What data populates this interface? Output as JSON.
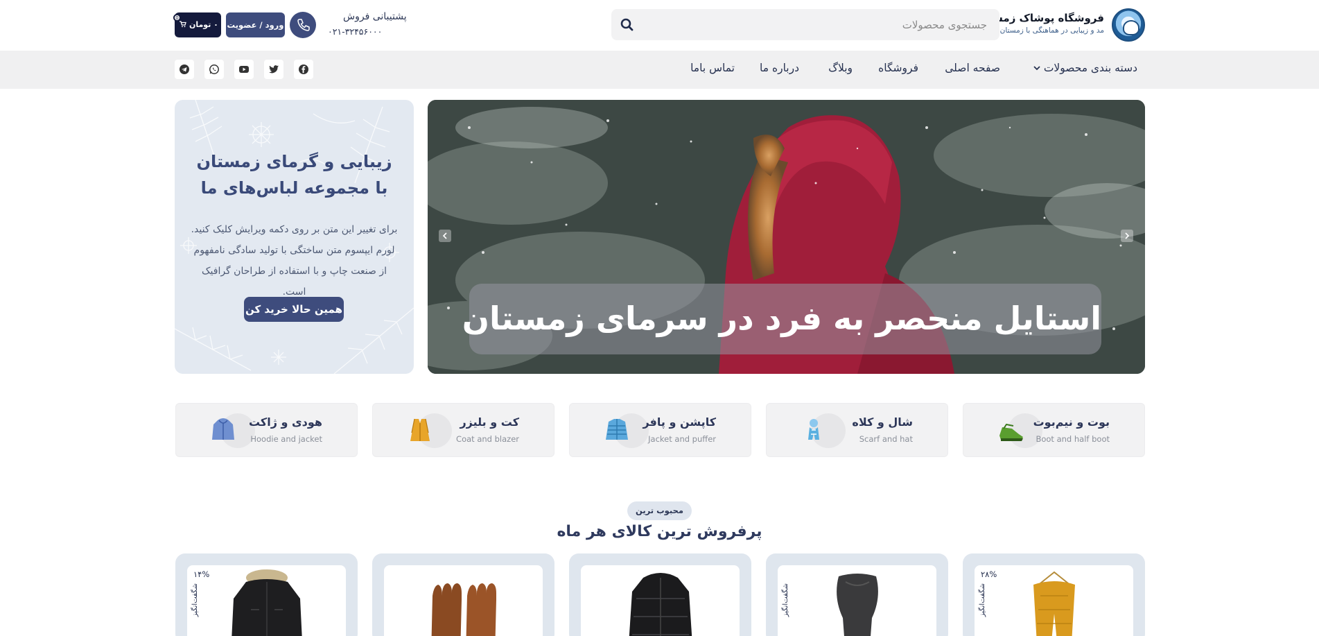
{
  "header": {
    "brand_title": "فروشگاه پوشاک زمستانه",
    "brand_subtitle": "مد و زیبایی در هماهنگی با زمستان",
    "search_placeholder": "جستجوی محصولات",
    "support_label": "پشتیبانی فروش",
    "support_phone": "۰۲۱-۳۲۴۵۶۰۰۰",
    "login_label": "ورود / عضویت",
    "cart_label": "۰ تومان",
    "cart_count": "0"
  },
  "nav": {
    "items": [
      "دسته بندی محصولات",
      "صفحه اصلی",
      "فروشگاه",
      "وبلاگ",
      "درباره ما",
      "تماس باما"
    ],
    "social": [
      "facebook-icon",
      "twitter-icon",
      "youtube-icon",
      "whatsapp-icon",
      "telegram-icon"
    ]
  },
  "promo": {
    "title": "زیبایی و گرمای زمستان با مجموعه لباس‌های ما",
    "text": "برای تغییر این متن بر روی دکمه ویرایش کلیک کنید. لورم ایپسوم متن ساختگی با تولید سادگی نامفهوم از صنعت چاپ و با استفاده از طراحان گرافیک است.",
    "button": "همین حالا خرید کن"
  },
  "slider": {
    "caption": "استایل منحصر به فرد در سرمای زمستان"
  },
  "categories": [
    {
      "title": "بوت و نیم‌بوت",
      "subtitle": "Boot and half boot",
      "icon": "boot-icon",
      "color": "#5a9e2f"
    },
    {
      "title": "شال و کلاه",
      "subtitle": "Scarf and hat",
      "icon": "scarf-icon",
      "color": "#5ab0e0"
    },
    {
      "title": "کاپشن و پافر",
      "subtitle": "Jacket and puffer",
      "icon": "puffer-icon",
      "color": "#5aa8dc"
    },
    {
      "title": "کت و بلیزر",
      "subtitle": "Coat and blazer",
      "icon": "coat-icon",
      "color": "#e8a52a"
    },
    {
      "title": "هودی و ژاکت",
      "subtitle": "Hoodie and jacket",
      "icon": "hoodie-icon",
      "color": "#6f8fd0"
    }
  ],
  "bestsellers": {
    "badge": "محبوب ترین",
    "title": "پرفروش ترین کالای هر ماه",
    "products": [
      {
        "discount": "۲۸%",
        "tag": "شگفت‌انگیز",
        "image": "yellow-scarf-image",
        "color": "#d99a1e"
      },
      {
        "discount": "",
        "tag": "شگفت‌انگیز",
        "image": "dark-scarf-image",
        "color": "#3a3a3c"
      },
      {
        "discount": "",
        "tag": "",
        "image": "black-puffer-image",
        "color": "#1b1b1d"
      },
      {
        "discount": "",
        "tag": "",
        "image": "leather-gloves-image",
        "color": "#8a4a22"
      },
      {
        "discount": "۱۴%",
        "tag": "شگفت‌انگیز",
        "image": "black-parka-image",
        "color": "#1e1e20"
      }
    ]
  },
  "colors": {
    "primary": "#3e4c7d",
    "dark": "#141a3c",
    "navbar_bg": "#f0f0f1",
    "card_bg": "#dfe6ee"
  }
}
